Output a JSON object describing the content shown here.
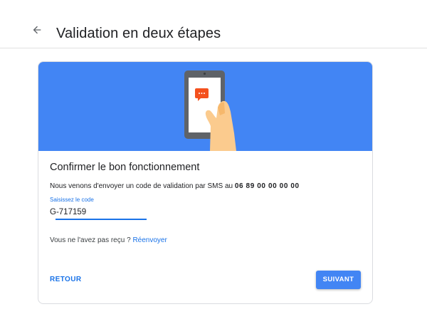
{
  "header": {
    "title": "Validation en deux étapes",
    "back_icon": "arrow-left-icon"
  },
  "card": {
    "banner_illustration": "phone-sms-illustration",
    "banner_color": "#4285f4",
    "heading": "Confirmer le bon fonctionnement",
    "sms_text": "Nous venons d'envoyer un code de validation par SMS au",
    "phone_number": "06 89 00 00 00 00",
    "code_field": {
      "label": "Saisissez le code",
      "value": "G-717159"
    },
    "resend_question": "Vous ne l'avez pas reçu ?",
    "resend_link": "Réenvoyer",
    "back_button": "RETOUR",
    "next_button": "SUIVANT"
  }
}
